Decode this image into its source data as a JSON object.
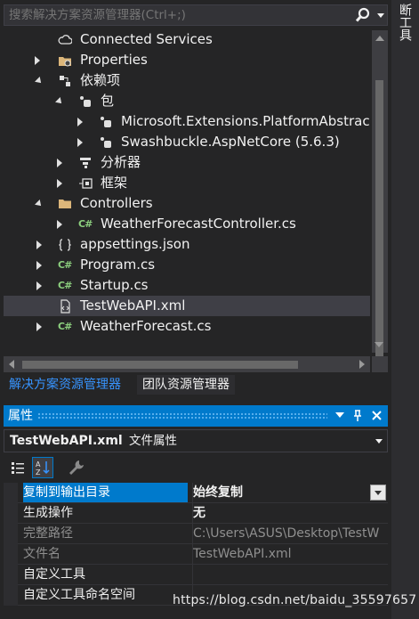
{
  "search": {
    "placeholder": "搜索解决方案资源管理器(Ctrl+;)",
    "icon": "search-icon"
  },
  "side_tab": {
    "label": "断工具"
  },
  "tree": [
    {
      "label": "Connected Services",
      "icon": "cloud-icon"
    },
    {
      "label": "Properties",
      "icon": "properties-folder-icon"
    },
    {
      "label": "依赖项",
      "icon": "dependencies-icon"
    },
    {
      "label": "包",
      "icon": "package-icon"
    },
    {
      "label": "Microsoft.Extensions.PlatformAbstract",
      "icon": "nuget-package-icon"
    },
    {
      "label": "Swashbuckle.AspNetCore (5.6.3)",
      "icon": "nuget-package-icon"
    },
    {
      "label": "分析器",
      "icon": "analyzer-icon"
    },
    {
      "label": "框架",
      "icon": "framework-icon"
    },
    {
      "label": "Controllers",
      "icon": "folder-icon"
    },
    {
      "label": "WeatherForecastController.cs",
      "icon": "csharp-file-icon"
    },
    {
      "label": "appsettings.json",
      "icon": "json-file-icon"
    },
    {
      "label": "Program.cs",
      "icon": "csharp-file-icon"
    },
    {
      "label": "Startup.cs",
      "icon": "csharp-file-icon"
    },
    {
      "label": "TestWebAPI.xml",
      "icon": "xml-file-icon"
    },
    {
      "label": "WeatherForecast.cs",
      "icon": "csharp-file-icon"
    }
  ],
  "bottom_tabs": {
    "solution_explorer": "解决方案资源管理器",
    "team_explorer": "团队资源管理器"
  },
  "properties": {
    "title": "属性",
    "object_name": "TestWebAPI.xml",
    "object_type": "文件属性",
    "rows": [
      {
        "name": "复制到输出目录",
        "value": "始终复制"
      },
      {
        "name": "生成操作",
        "value": "无"
      },
      {
        "name": "完整路径",
        "value": "C:\\Users\\ASUS\\Desktop\\TestW"
      },
      {
        "name": "文件名",
        "value": "TestWebAPI.xml"
      },
      {
        "name": "自定义工具",
        "value": ""
      },
      {
        "name": "自定义工具命名空间",
        "value": ""
      }
    ]
  },
  "watermark": "https://blog.csdn.net/baidu_35597657",
  "colors": {
    "accent": "#007acc",
    "background": "#252526",
    "selection": "#3f3f46",
    "link": "#3794ff"
  }
}
